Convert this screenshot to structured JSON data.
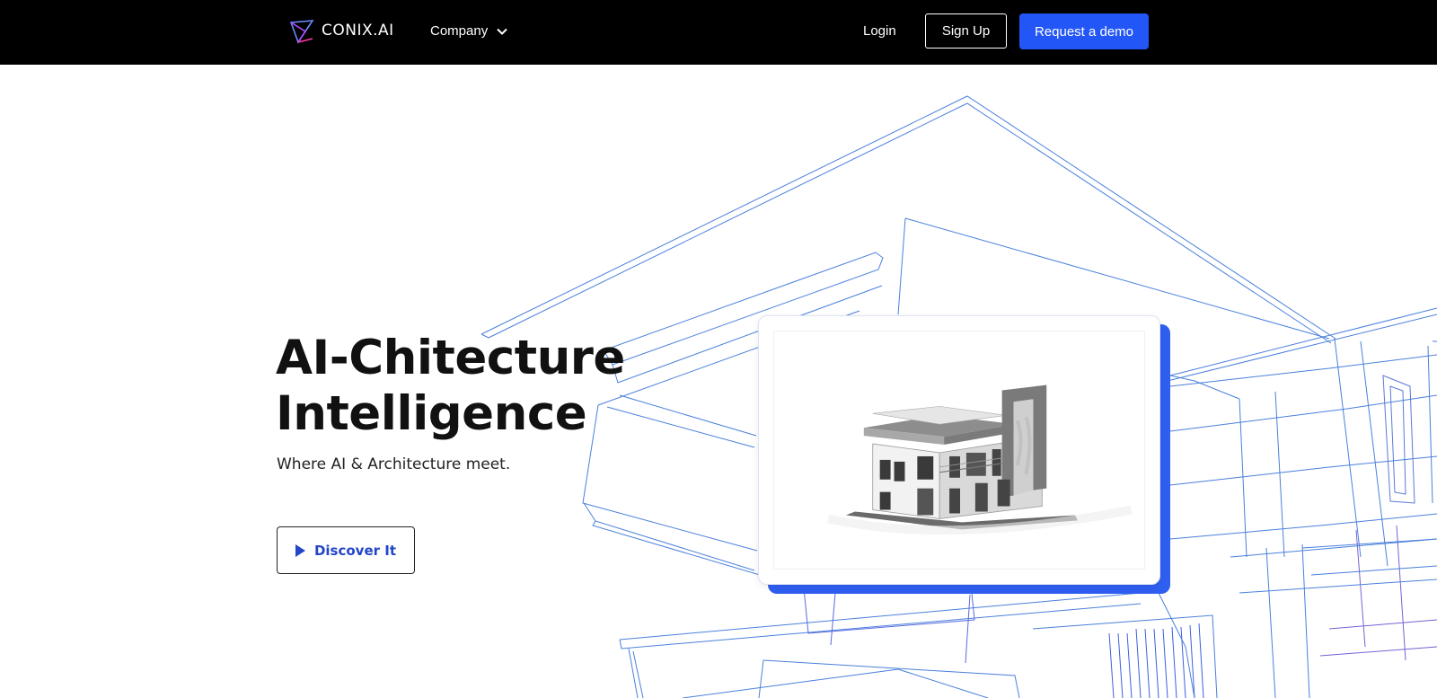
{
  "nav": {
    "brand": "CONIX.AI",
    "company_label": "Company",
    "login_label": "Login",
    "signup_label": "Sign Up",
    "demo_label": "Request a demo"
  },
  "hero": {
    "title_line1": "AI-Chitecture",
    "title_line2": "Intelligence",
    "subtitle": "Where AI & Architecture meet.",
    "cta_label": "Discover It"
  },
  "colors": {
    "accent": "#2356f6",
    "nav_bg": "#000000",
    "wire": "#4a7fd8",
    "wire_purple": "#8a5bd0"
  },
  "icons": {
    "logo": "conix-logo-icon",
    "chevron": "chevron-down-icon",
    "play": "play-icon"
  }
}
